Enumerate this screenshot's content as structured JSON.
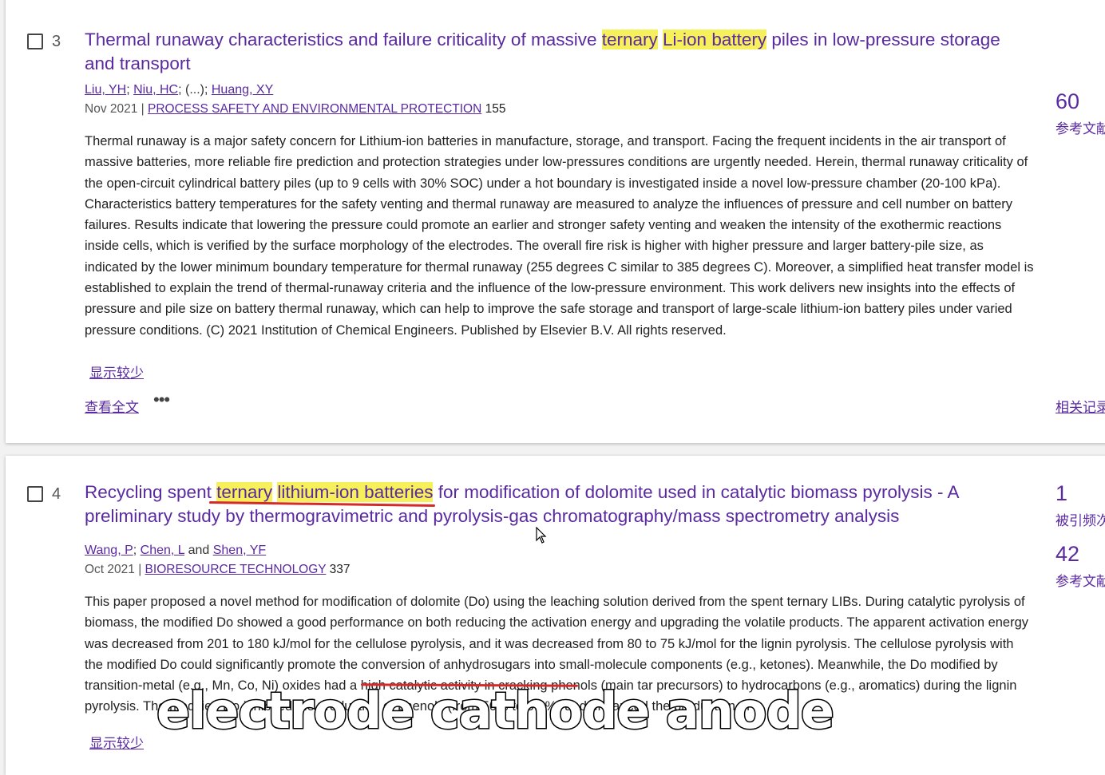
{
  "records": [
    {
      "rank": "3",
      "title_parts": [
        {
          "text": "Thermal runaway characteristics and failure criticality of massive ",
          "hl": false
        },
        {
          "text": "ternary",
          "hl": true
        },
        {
          "text": " ",
          "hl": false
        },
        {
          "text": "Li-ion battery",
          "hl": true
        },
        {
          "text": " piles in low-pressure storage and transport",
          "hl": false
        }
      ],
      "authors": [
        "Liu, YH",
        "Niu, HC",
        "Huang, XY"
      ],
      "authors_ellipsis": "(...)",
      "date": "Nov 2021",
      "journal": "PROCESS SAFETY AND ENVIRONMENTAL PROTECTION",
      "volume": "155",
      "abstract": "Thermal runaway is a major safety concern for Lithium-ion batteries in manufacture, storage, and transport. Facing the frequent incidents in the air transport of massive batteries, more reliable fire prediction and protection strategies under low-pressures conditions are urgently needed. Herein, thermal runaway criticality of the open-circuit cylindrical battery piles (up to 9 cells with 30% SOC) under a hot boundary is investigated inside a novel low-pressure chamber (20-100 kPa). Characteristics battery temperatures for the safety venting and thermal runaway are measured to analyze the influences of pressure and cell number on battery failures. Results indicate that lowering the pressure could promote an earlier and stronger safety venting and weaken the intensity of the exothermic reactions inside cells, which is verified by the surface morphology of the electrodes. The overall fire risk is higher with higher pressure and larger battery-pile size, as indicated by the lower minimum boundary temperature for thermal runaway (255 degrees C similar to 385 degrees C). Moreover, a simplified heat transfer model is established to explain the trend of thermal-runaway criteria and the influence of the low-pressure environment. This work delivers new insights into the effects of pressure and pile size on battery thermal runaway, which can help to improve the safe storage and transport of large-scale lithium-ion battery piles under varied pressure conditions. (C) 2021 Institution of Chemical Engineers. Published by Elsevier B.V. All rights reserved.",
      "show_less": "显示较少",
      "full_text": "查看全文",
      "more": "•••",
      "metrics": [
        {
          "value": "60",
          "label": "参考文献"
        }
      ],
      "related": "相关记录"
    },
    {
      "rank": "4",
      "title_parts": [
        {
          "text": "Recycling spent ",
          "hl": false
        },
        {
          "text": "ternary",
          "hl": true
        },
        {
          "text": " ",
          "hl": false
        },
        {
          "text": "lithium-ion batteries",
          "hl": true
        },
        {
          "text": " for modification of dolomite used in catalytic biomass pyrolysis - A preliminary study by thermogravimetric and pyrolysis-gas chromatography/mass spectrometry analysis",
          "hl": false
        }
      ],
      "authors": [
        "Wang, P",
        "Chen, L",
        "Shen, YF"
      ],
      "authors_joiner": "and",
      "date": "Oct 2021",
      "journal": "BIORESOURCE TECHNOLOGY",
      "volume": "337",
      "abstract": "This paper proposed a novel method for modification of dolomite (Do) using the leaching solution derived from the spent ternary LIBs. During catalytic pyrolysis of biomass, the modified Do showed a good performance on both reducing the activation energy and upgrading the volatile products. The apparent activation energy was decreased from 201 to 180 kJ/mol for the cellulose pyrolysis, and it was decreased from 80 to 75 kJ/mol for the lignin pyrolysis. The cellulose pyrolysis with the modified Do could significantly promote the conversion of anhydrosugars into small-molecule components (e.g., ketones). Meanwhile, the Do modified by transition-metal (e.g., Mn, Co, Ni) oxides had a high catalytic activity in cracking phenols (main tar precursors) to hydrocarbons (e.g., aromatics) during the lignin pyrolysis. The modified Do inhibited the production of phenols (from 50% to 5.8%) and enhanced the production of",
      "show_less": "显示较少",
      "metrics": [
        {
          "value": "1",
          "label": "被引频次"
        },
        {
          "value": "42",
          "label": "参考文献"
        }
      ]
    }
  ],
  "caption": "electrode cathode anode",
  "colors": {
    "link": "#5a2aa0",
    "highlight": "#f6f05a",
    "underline_red": "#d62a2a"
  }
}
